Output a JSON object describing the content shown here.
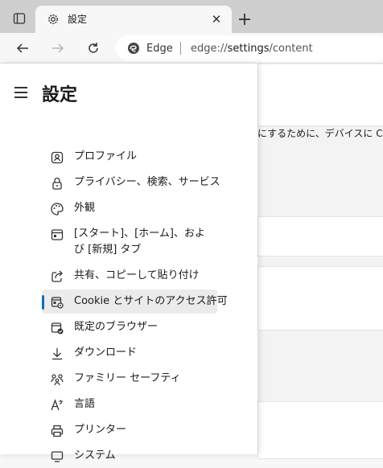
{
  "browser": {
    "tab_title": "設定",
    "address": {
      "brand": "Edge",
      "url_prefix": "edge://",
      "url_highlight": "settings",
      "url_suffix": "/content"
    }
  },
  "content": {
    "partial_text": "にするために、デバイスに Coo"
  },
  "menu": {
    "title": "設定",
    "items": [
      {
        "label": "プロファイル",
        "icon": "profile-icon"
      },
      {
        "label": "プライバシー、検索、サービス",
        "icon": "lock-icon"
      },
      {
        "label": "外観",
        "icon": "palette-icon"
      },
      {
        "label": "[スタート]、[ホーム]、および [新規] タブ",
        "icon": "home-tab-icon"
      },
      {
        "label": "共有、コピーして貼り付け",
        "icon": "share-icon"
      },
      {
        "label": "Cookie とサイトのアクセス許可",
        "icon": "site-permissions-icon",
        "active": true
      },
      {
        "label": "既定のブラウザー",
        "icon": "default-browser-icon"
      },
      {
        "label": "ダウンロード",
        "icon": "download-icon"
      },
      {
        "label": "ファミリー セーフティ",
        "icon": "family-icon"
      },
      {
        "label": "言語",
        "icon": "language-icon"
      },
      {
        "label": "プリンター",
        "icon": "printer-icon"
      },
      {
        "label": "システム",
        "icon": "system-icon"
      }
    ]
  }
}
